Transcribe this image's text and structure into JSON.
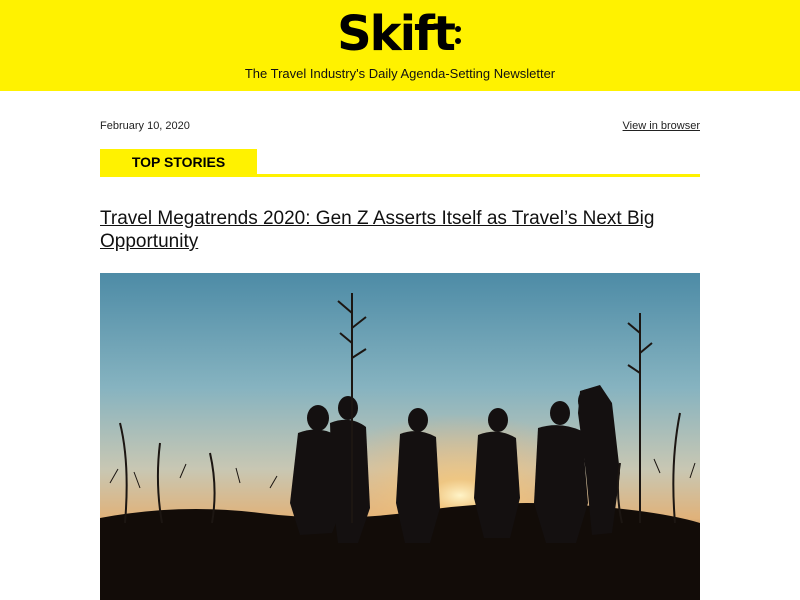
{
  "header": {
    "logo_text": "Skift",
    "tagline": "The Travel Industry's Daily Agenda-Setting Newsletter",
    "accent_color": "#fff200"
  },
  "meta": {
    "date": "February 10, 2020",
    "view_in_browser": "View in browser"
  },
  "section": {
    "label": "TOP STORIES"
  },
  "story": {
    "headline": "Travel Megatrends 2020: Gen Z Asserts Itself as Travel’s Next Big Opportunity",
    "image_icon": "hero-photo"
  }
}
